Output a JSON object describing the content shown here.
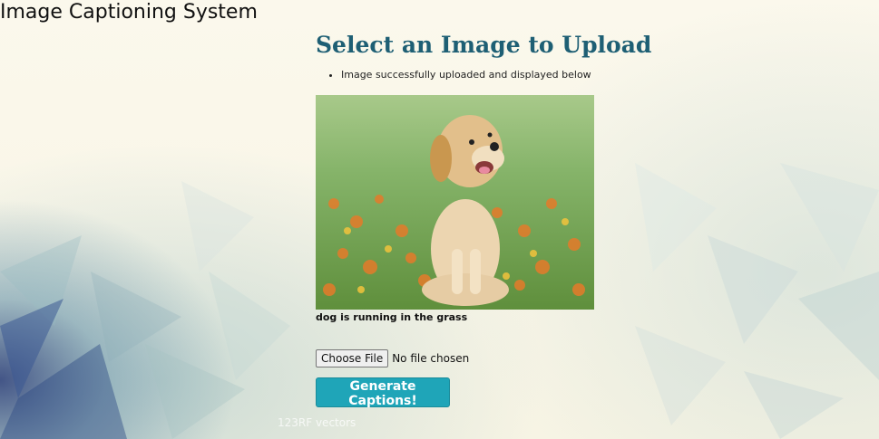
{
  "app": {
    "title": "Image Captioning System"
  },
  "main": {
    "heading": "Select an Image to Upload",
    "messages": [
      "Image successfully uploaded and displayed below"
    ],
    "caption": "dog is running in the grass",
    "file_input": {
      "button_label": "Choose File",
      "status": "No file chosen"
    },
    "generate_button_label": "Generate Captions!"
  },
  "watermark": "123RF vectors",
  "colors": {
    "heading": "#1e5f74",
    "button": "#1fa5b8",
    "background": "#fbf8ec"
  },
  "icons": [
    "bullet-icon"
  ]
}
